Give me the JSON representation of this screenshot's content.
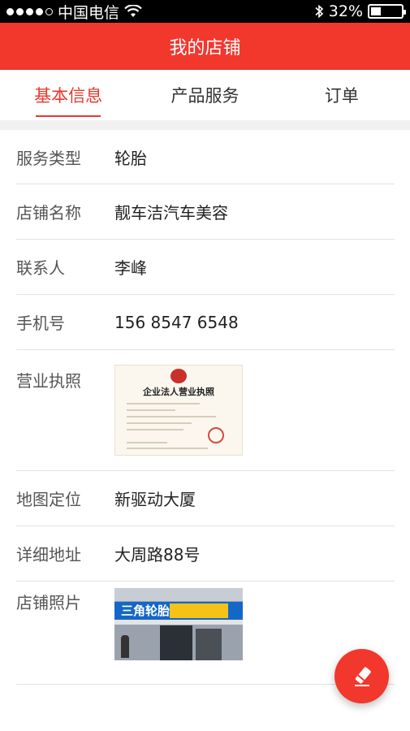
{
  "status_bar": {
    "carrier": "中国电信",
    "signal_bars_filled": 4,
    "signal_bars_total": 5,
    "battery_text": "32%",
    "battery_level": 0.32,
    "icons": [
      "wifi-icon",
      "bluetooth-icon",
      "battery-icon"
    ]
  },
  "navbar": {
    "title": "我的店铺"
  },
  "tabs": [
    {
      "label": "基本信息",
      "active": true
    },
    {
      "label": "产品服务",
      "active": false
    },
    {
      "label": "订单",
      "active": false
    }
  ],
  "info": {
    "service_type": {
      "label": "服务类型",
      "value": "轮胎"
    },
    "shop_name": {
      "label": "店铺名称",
      "value": "靓车洁汽车美容"
    },
    "contact": {
      "label": "联系人",
      "value": "李峰"
    },
    "phone": {
      "label": "手机号",
      "value": "156 8547 6548"
    },
    "license": {
      "label": "营业执照",
      "image_title": "企业法人营业执照"
    },
    "map_location": {
      "label": "地图定位",
      "value": "新驱动大厦"
    },
    "address": {
      "label": "详细地址",
      "value": "大周路88号"
    },
    "shop_photo": {
      "label": "店铺照片",
      "sign_text": "三角轮胎"
    }
  },
  "fab": {
    "icon": "edit-icon"
  },
  "colors": {
    "accent": "#f2372d",
    "tab_active": "#e8382d"
  }
}
